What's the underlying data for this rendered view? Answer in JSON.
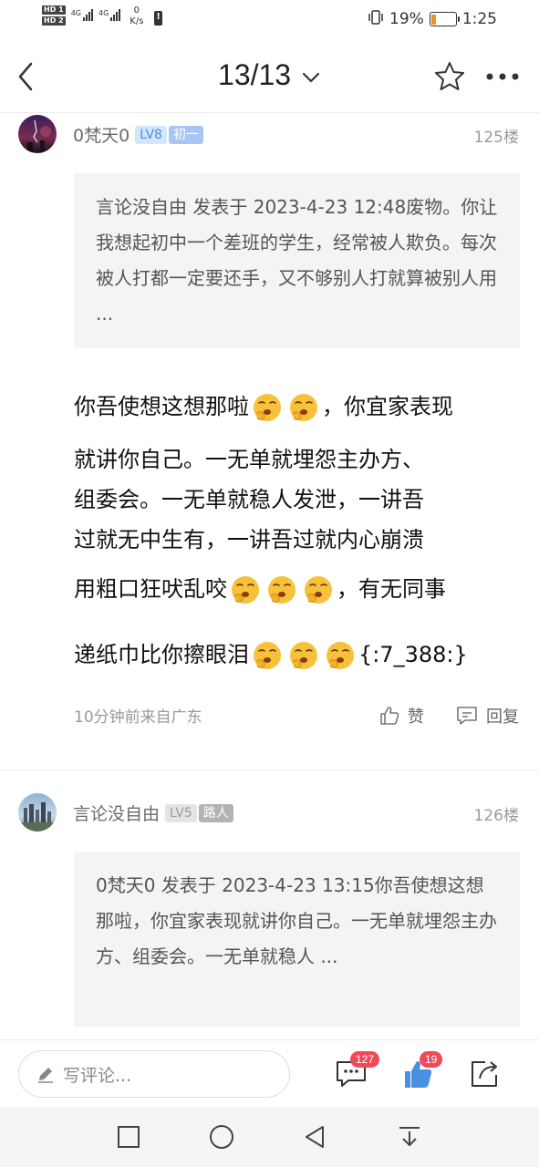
{
  "status_bar": {
    "hd1": "HD 1",
    "hd2": "HD 2",
    "net1": "4G",
    "net2": "4G",
    "speed_value": "0",
    "speed_unit": "K/s",
    "battery_percent": "19%",
    "battery_level": 0.19,
    "time": "1:25"
  },
  "nav": {
    "page_indicator": "13/13"
  },
  "posts": [
    {
      "username": "0梵天0",
      "level": "LV8",
      "rank": "初一",
      "floor": "125楼",
      "quote": "言论没自由 发表于 2023-4-23 12:48废物。你让我想起初中一个差班的学生，经常被人欺负。每次被人打都一定要还手，又不够别人打就算被别人用 ...",
      "lines": [
        {
          "a": "你吾使想这想那啦",
          "b": "，你宜家表现"
        },
        {
          "a": "就讲你自己。一无单就埋怨主办方、"
        },
        {
          "a": "组委会。一无单就稳人发泄，一讲吾"
        },
        {
          "a": "过就无中生有，一讲吾过就内心崩溃"
        },
        {
          "a": "用粗口狂吠乱咬",
          "b": "，有无同事"
        },
        {
          "a": "递纸巾比你擦眼泪",
          "b": "{:7_388:}"
        }
      ],
      "time_source": "10分钟前来自广东",
      "like_label": "赞",
      "reply_label": "回复"
    },
    {
      "username": "言论没自由",
      "level": "LV5",
      "rank": "路人",
      "floor": "126楼",
      "quote": "0梵天0 发表于 2023-4-23 13:15你吾使想这想那啦，你宜家表现就讲你自己。一无单就埋怨主办方、组委会。一无单就稳人 ..."
    }
  ],
  "comment_bar": {
    "placeholder": "写评论...",
    "comment_count": "127",
    "like_count": "19"
  },
  "colors": {
    "lv8_bg": "#d4e6fb",
    "lv8_text": "#4a8fe8",
    "rank1_bg": "#a9c6f3",
    "lv5_bg": "#e4e4e4",
    "rank2_bg": "#b3b3b3",
    "badge": "#ef4a55",
    "battery": "#f0901a"
  }
}
